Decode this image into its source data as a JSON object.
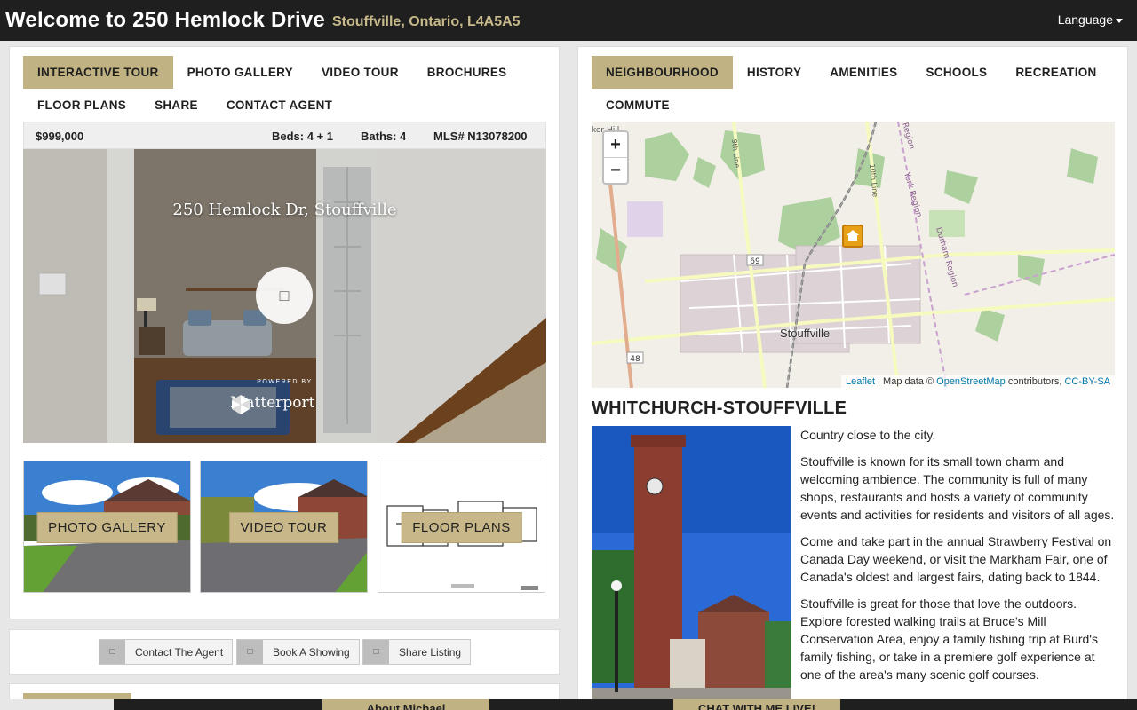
{
  "header": {
    "title": "Welcome to 250 Hemlock Drive",
    "subtitle": "Stouffville, Ontario, L4A5A5",
    "language_label": "Language"
  },
  "left_tabs": [
    {
      "label": "INTERACTIVE TOUR",
      "active": true
    },
    {
      "label": "PHOTO GALLERY",
      "active": false
    },
    {
      "label": "VIDEO TOUR",
      "active": false
    },
    {
      "label": "BROCHURES",
      "active": false
    },
    {
      "label": "FLOOR PLANS",
      "active": false
    },
    {
      "label": "SHARE",
      "active": false
    },
    {
      "label": "CONTACT AGENT",
      "active": false
    }
  ],
  "listing": {
    "price": "$999,000",
    "beds": "Beds: 4 + 1",
    "baths": "Baths: 4",
    "mls": "MLS# N13078200"
  },
  "tour": {
    "address": "250 Hemlock Dr, Stouffville",
    "play_icon": "play-icon",
    "powered_by": "POWERED BY",
    "brand": "Matterport"
  },
  "thumbnails": [
    {
      "label": "PHOTO GALLERY"
    },
    {
      "label": "VIDEO TOUR"
    },
    {
      "label": "FLOOR PLANS"
    }
  ],
  "actions": [
    {
      "label": "Contact The Agent",
      "icon": "contact-icon"
    },
    {
      "label": "Book A Showing",
      "icon": "calendar-icon"
    },
    {
      "label": "Share Listing",
      "icon": "share-icon"
    }
  ],
  "right_tabs": [
    {
      "label": "NEIGHBOURHOOD",
      "active": true
    },
    {
      "label": "HISTORY",
      "active": false
    },
    {
      "label": "AMENITIES",
      "active": false
    },
    {
      "label": "SCHOOLS",
      "active": false
    },
    {
      "label": "RECREATION",
      "active": false
    },
    {
      "label": "COMMUTE",
      "active": false
    }
  ],
  "map": {
    "zoom_in": "+",
    "zoom_out": "−",
    "town_label": "Stouffville",
    "road_69": "69",
    "road_48": "48",
    "label_9th": "9th Line",
    "label_10th": "10th Line",
    "label_york": "York Region",
    "label_durham": "Durham Region",
    "label_region": "Region",
    "label_hill": "ker Hill",
    "attribution": {
      "leaflet": "Leaflet",
      "map_data": " | Map data © ",
      "osm": "OpenStreetMap",
      "contrib": " contributors, ",
      "license": "CC-BY-SA"
    }
  },
  "neighbourhood": {
    "title": "WHITCHURCH-STOUFFVILLE",
    "paragraphs": [
      "Country close to the city.",
      "Stouffville is known for its small town charm and welcoming ambience. The community is full of many shops, restaurants and hosts a variety of community events and activities for residents and visitors of all ages.",
      "Come and take part in the annual Strawberry Festival on Canada Day weekend, or visit the Markham Fair, one of Canada's oldest and largest fairs, dating back to 1844.",
      "Stouffville is great for those that love the outdoors. Explore forested walking trails at Bruce's Mill Conservation Area, enjoy a family fishing trip at Burd's family fishing, or take in a premiere golf experience at one of the area's many scenic golf courses."
    ]
  },
  "footer": {
    "about_label": "About Michael",
    "chat_label": "CHAT WITH ME LIVE!"
  },
  "colors": {
    "accent": "#c0b283",
    "header_bg": "#1f1f1f",
    "subtitle": "#c7b98a"
  }
}
